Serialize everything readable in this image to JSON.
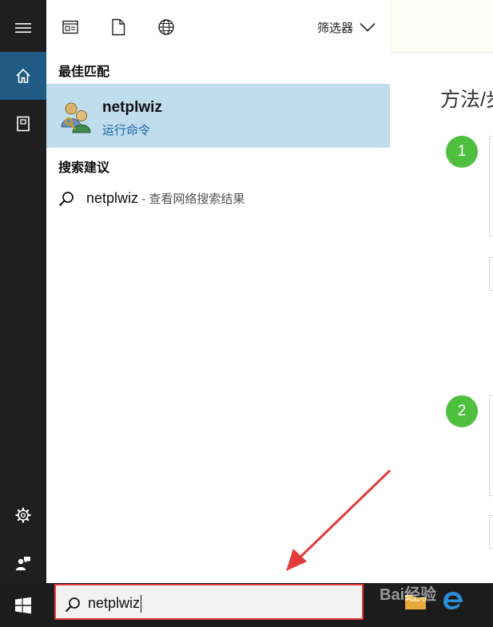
{
  "left_rail": {
    "items": [
      {
        "icon": "hamburger-menu-icon"
      },
      {
        "icon": "home-icon"
      },
      {
        "icon": "notebook-icon"
      },
      {
        "icon": "gear-icon"
      },
      {
        "icon": "feedback-icon"
      }
    ]
  },
  "topbar": {
    "icons": [
      "apps-icon",
      "documents-icon",
      "web-globe-icon"
    ],
    "filter_label": "筛选器"
  },
  "best_match": {
    "heading": "最佳匹配",
    "title": "netplwiz",
    "subtitle": "运行命令"
  },
  "suggestions": {
    "heading": "搜索建议",
    "items": [
      {
        "query": "netplwiz",
        "hint": " - 查看网络搜索结果"
      }
    ]
  },
  "search": {
    "value": "netplwiz"
  },
  "background": {
    "title": "方法/步",
    "steps": [
      "1",
      "2"
    ]
  },
  "watermark": "Bai经验",
  "colors": {
    "rail": "#1f1f1f",
    "active_rail": "#1f5b83",
    "best_match_bg": "#c0ddee",
    "subtitle": "#1a66a6",
    "annotation_red": "#e33b3b",
    "step_green": "#4fbf40"
  }
}
